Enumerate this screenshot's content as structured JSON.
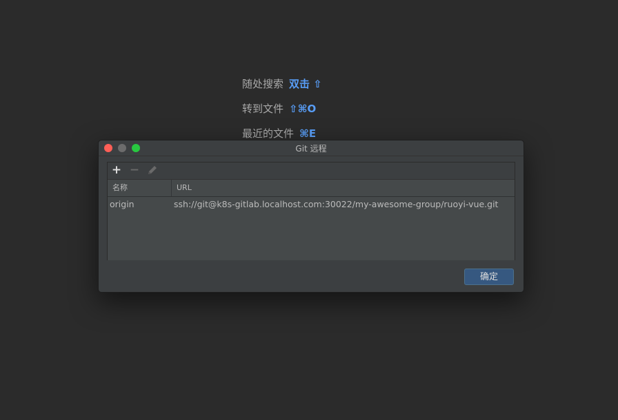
{
  "hints": [
    {
      "label": "随处搜索",
      "shortcut": "双击 ⇧"
    },
    {
      "label": "转到文件",
      "shortcut": "⇧⌘O"
    },
    {
      "label": "最近的文件",
      "shortcut": "⌘E"
    }
  ],
  "dialog": {
    "title": "Git 远程",
    "toolbar": {
      "add_icon": "plus-icon",
      "remove_icon": "minus-icon",
      "edit_icon": "pencil-icon"
    },
    "columns": [
      "名称",
      "URL"
    ],
    "remotes": [
      {
        "name": "origin",
        "url": "ssh://git@k8s-gitlab.localhost.com:30022/my-awesome-group/ruoyi-vue.git"
      }
    ],
    "ok_label": "确定"
  },
  "colors": {
    "background": "#2b2b2b",
    "dialog": "#3c3f41",
    "accent": "#589df6",
    "button": "#365880",
    "close": "#fe5f57",
    "maximize": "#28c840"
  }
}
